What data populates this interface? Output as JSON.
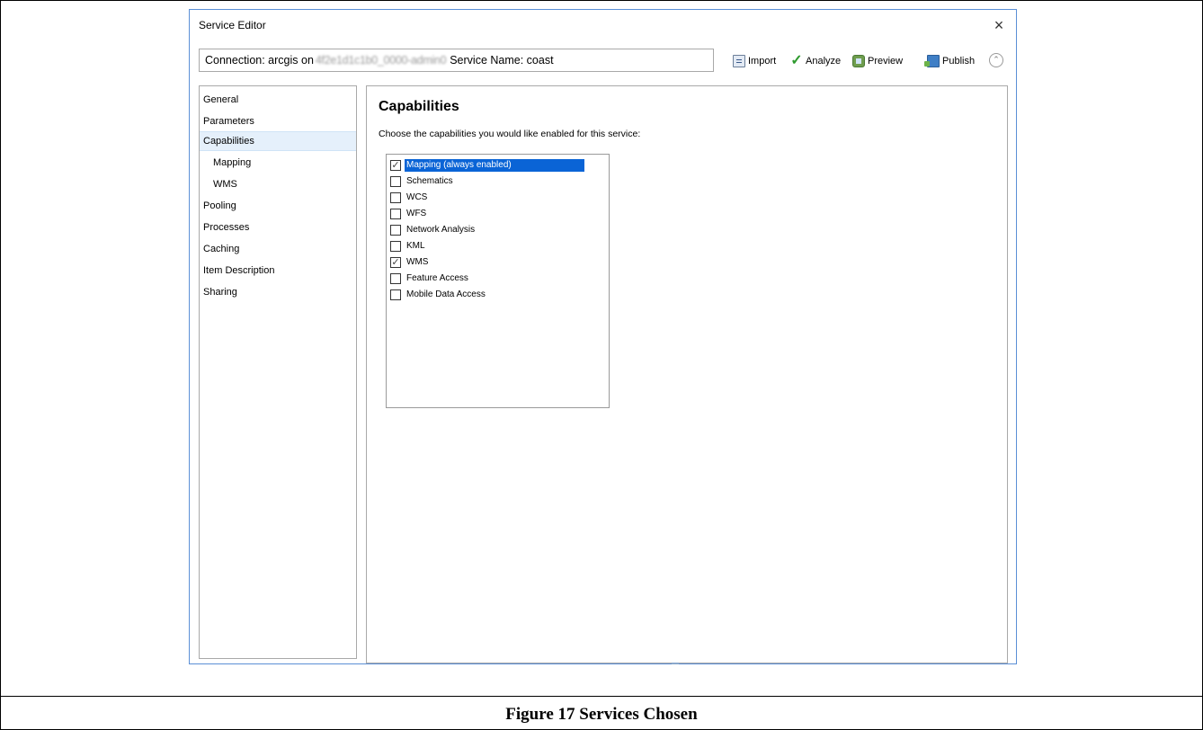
{
  "window": {
    "title": "Service Editor",
    "close_icon": "×"
  },
  "connection": {
    "prefix": "Connection: arcgis on",
    "host": "4f2e1d1c1b0_0000-admin0",
    "service_name": "Service Name: coast"
  },
  "toolbar": {
    "import_label": "Import",
    "analyze_label": "Analyze",
    "preview_label": "Preview",
    "publish_label": "Publish",
    "collapse_icon": "⌃"
  },
  "sidebar": {
    "items": [
      {
        "label": "General"
      },
      {
        "label": "Parameters"
      },
      {
        "label": "Capabilities",
        "selected": true
      },
      {
        "label": "Mapping",
        "indent": true
      },
      {
        "label": "WMS",
        "indent": true
      },
      {
        "label": "Pooling"
      },
      {
        "label": "Processes"
      },
      {
        "label": "Caching"
      },
      {
        "label": "Item Description"
      },
      {
        "label": "Sharing"
      }
    ]
  },
  "panel": {
    "heading": "Capabilities",
    "instruction": "Choose the capabilities you would like enabled for this service:",
    "capabilities": [
      {
        "label": "Mapping (always enabled)",
        "checked": true
      },
      {
        "label": "Schematics",
        "checked": false
      },
      {
        "label": "WCS",
        "checked": false
      },
      {
        "label": "WFS",
        "checked": false
      },
      {
        "label": "Network Analysis",
        "checked": false
      },
      {
        "label": "KML",
        "checked": false
      },
      {
        "label": "WMS",
        "checked": true
      },
      {
        "label": "Feature Access",
        "checked": false
      },
      {
        "label": "Mobile Data Access",
        "checked": false
      }
    ]
  },
  "caption": "Figure 17 Services Chosen",
  "colors": {
    "window_border": "#5b8fd6",
    "selection": "#0a64d6",
    "nav_selected": "#e5f0fb"
  }
}
